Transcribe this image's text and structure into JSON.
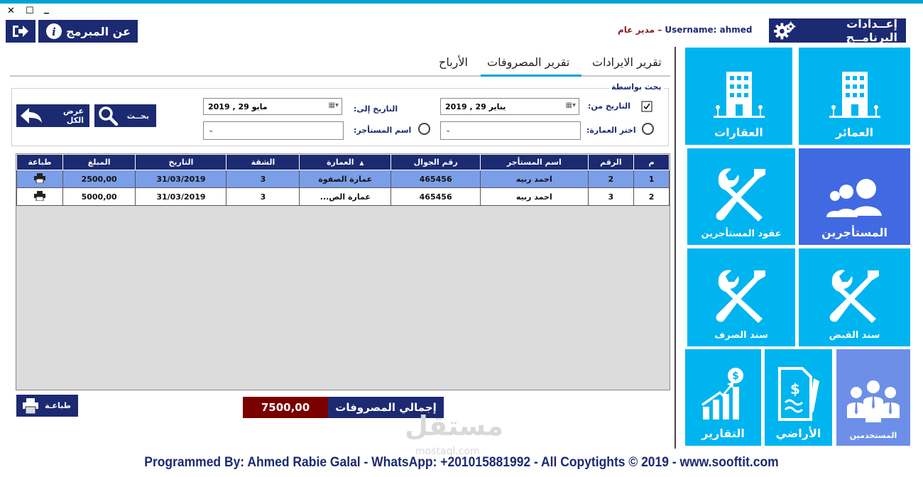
{
  "window": {
    "close": "✕",
    "restore": "☐",
    "minimize": "▁"
  },
  "header": {
    "about_label": "عن المبرمج",
    "user_info": "Username: ahmed",
    "user_role": "مدير عام",
    "settings_label": "إعــدادات البرنامــج"
  },
  "tabs": [
    {
      "label": "تقرير الايرادات"
    },
    {
      "label": "تقرير المصروفات"
    },
    {
      "label": "الأرباح"
    }
  ],
  "search": {
    "group_label": "بحث بواسطة",
    "date_from_label": "التاريخ من:",
    "date_from_value": "2019 ,  يناير   29",
    "date_to_label": "التاريخ إلى:",
    "date_to_value": "2019 ,  مايو   29",
    "building_label": "اختر العمارة:",
    "tenant_label": "اسم المستأجر:",
    "search_button": "بحــث",
    "show_all_button": "عرض الكل"
  },
  "table": {
    "headers": [
      "م",
      "الرقم",
      "اسم المستأجر",
      "رقم الجوال",
      "العمارة",
      "الشقة",
      "التاريخ",
      "المبلغ",
      "طباعة"
    ],
    "rows": [
      {
        "m": "1",
        "num": "2",
        "tenant": "احمد ربيه",
        "phone": "465456",
        "building": "عمارة الصفوة",
        "apt": "3",
        "date": "31/03/2019",
        "amount": "2500,00"
      },
      {
        "m": "2",
        "num": "3",
        "tenant": "احمد ربيه",
        "phone": "465456",
        "building": "عمارة الص...",
        "apt": "3",
        "date": "31/03/2019",
        "amount": "5000,00"
      }
    ]
  },
  "footer_bar": {
    "print_label": "طباعـة",
    "total_label": "إجمالي المصروفات",
    "total_value": "7500,00"
  },
  "tiles": {
    "buildings": "العمائر",
    "properties": "العقارات",
    "tenants": "المستأجرين",
    "contracts": "عقود المستأجرين",
    "receipt": "سند القبض",
    "payment": "سند الصرف",
    "users": "المستخدمين",
    "lands": "الأراضي",
    "reports": "التقارير"
  },
  "watermark": {
    "ar": "مستقل",
    "en": "mostaql.com"
  },
  "footer_text": "Programmed By: Ahmed Rabie Galal - WhatsApp: +201015881992 - All Copytights © 2019 - www.sooftit.com",
  "colors": {
    "navy": "#1c2a72",
    "tile_blue": "#00b4f0",
    "tile_dark": "#4169e1",
    "tile_lavender": "#6d8fe8",
    "total_red": "#7a0000"
  }
}
